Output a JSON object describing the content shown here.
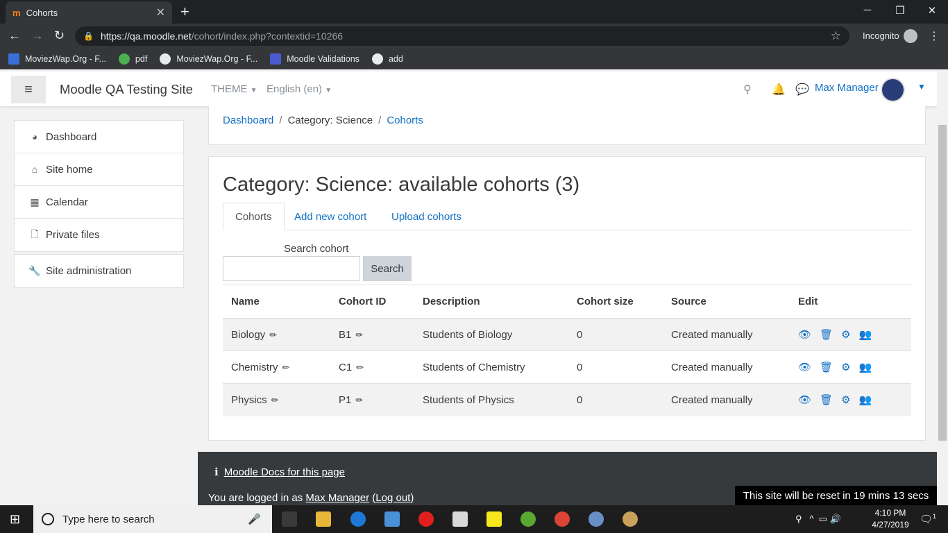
{
  "browser": {
    "tab_title": "Cohorts",
    "tab_favicon": "m",
    "url_host": "https://qa.moodle.net",
    "url_path": "/cohort/index.php?contextid=10266",
    "incognito_label": "Incognito",
    "bookmarks": [
      {
        "label": "MoviezWap.Org - F...",
        "icon": "moviezwap-icon"
      },
      {
        "label": "pdf",
        "icon": "pdf-icon"
      },
      {
        "label": "MoviezWap.Org - F...",
        "icon": "globe-icon"
      },
      {
        "label": "Moodle Validations",
        "icon": "moodle-icon"
      },
      {
        "label": "add",
        "icon": "globe-icon"
      }
    ]
  },
  "navbar": {
    "site_name": "Moodle QA Testing Site",
    "theme_label": "THEME",
    "language_label": "English (en)",
    "user_name": "Max Manager"
  },
  "sidebar": {
    "items": [
      {
        "label": "Dashboard",
        "icon": "dashboard-icon"
      },
      {
        "label": "Site home",
        "icon": "home-icon"
      },
      {
        "label": "Calendar",
        "icon": "calendar-icon"
      },
      {
        "label": "Private files",
        "icon": "file-icon"
      }
    ],
    "admin": {
      "label": "Site administration",
      "icon": "wrench-icon"
    }
  },
  "breadcrumb": {
    "items": [
      "Dashboard",
      "Category: Science",
      "Cohorts"
    ]
  },
  "main": {
    "heading": "Category: Science: available cohorts (3)",
    "tabs": [
      "Cohorts",
      "Add new cohort",
      "Upload cohorts"
    ],
    "search_label": "Search cohort",
    "search_value": "",
    "search_button": "Search",
    "table": {
      "headers": [
        "Name",
        "Cohort ID",
        "Description",
        "Cohort size",
        "Source",
        "Edit"
      ],
      "rows": [
        {
          "name": "Biology",
          "id": "B1",
          "description": "Students of Biology",
          "size": "0",
          "source": "Created manually"
        },
        {
          "name": "Chemistry",
          "id": "C1",
          "description": "Students of Chemistry",
          "size": "0",
          "source": "Created manually"
        },
        {
          "name": "Physics",
          "id": "P1",
          "description": "Students of Physics",
          "size": "0",
          "source": "Created manually"
        }
      ]
    }
  },
  "footer": {
    "docs_link": "Moodle Docs for this page",
    "logged_prefix": "You are logged in as ",
    "logged_user": "Max Manager",
    "logout_label": "Log out",
    "reset_notice": "This site will be reset in 19 mins 13 secs"
  },
  "taskbar": {
    "search_placeholder": "Type here to search",
    "time": "4:10 PM",
    "date": "4/27/2019",
    "notification_count": "1"
  },
  "colors": {
    "link": "#0f6fc5",
    "footer_bg": "#373a3c",
    "chrome_bg": "#35363a"
  }
}
